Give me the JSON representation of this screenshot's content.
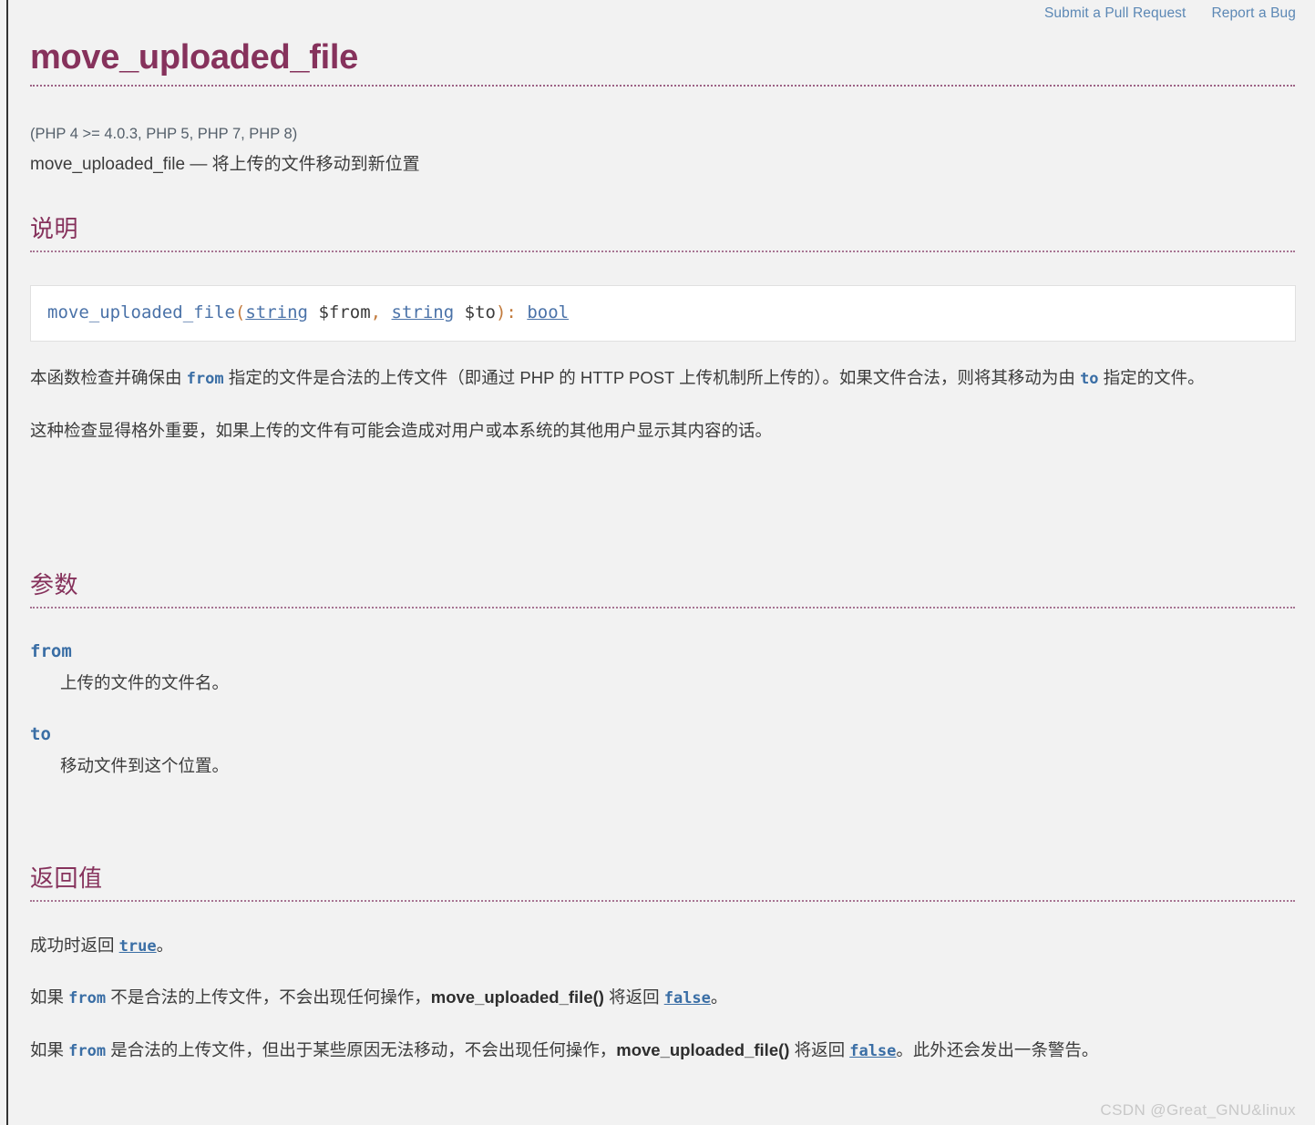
{
  "topbar": {
    "links": [
      {
        "label": "Submit a Pull Request",
        "name": "submit-pull-request-link"
      },
      {
        "label": "Report a Bug",
        "name": "report-a-bug-link"
      }
    ]
  },
  "page": {
    "title": "move_uploaded_file",
    "verinfo": "(PHP 4 >= 4.0.3, PHP 5, PHP 7, PHP 8)",
    "purpose": "move_uploaded_file — 将上传的文件移动到新位置"
  },
  "description": {
    "heading": "说明",
    "signature": {
      "function": "move_uploaded_file",
      "open_paren": "(",
      "arg1_type": "string",
      "arg1_name": "$from",
      "comma": ", ",
      "arg2_type": "string",
      "arg2_name": "$to",
      "close_paren": ")",
      "colon": ": ",
      "return_type": "bool"
    },
    "para1": {
      "t1": "本函数检查并确保由 ",
      "from": "from",
      "t2": " 指定的文件是合法的上传文件（即通过 PHP 的 HTTP POST 上传机制所上传的）。如果文件合法，则将其移动为由 ",
      "to": "to",
      "t3": " 指定的文件。"
    },
    "para2": "这种检查显得格外重要，如果上传的文件有可能会造成对用户或本系统的其他用户显示其内容的话。"
  },
  "parameters": {
    "heading": "参数",
    "items": [
      {
        "name": "from",
        "desc": "上传的文件的文件名。"
      },
      {
        "name": "to",
        "desc": "移动文件到这个位置。"
      }
    ]
  },
  "returnvalues": {
    "heading": "返回值",
    "para1": {
      "t1": "成功时返回 ",
      "true": "true",
      "t2": "。"
    },
    "para2": {
      "t1": "如果 ",
      "from": "from",
      "t2": " 不是合法的上传文件，不会出现任何操作，",
      "fn": "move_uploaded_file()",
      "t3": " 将返回 ",
      "false": "false",
      "t4": "。"
    },
    "para3": {
      "t1": "如果 ",
      "from": "from",
      "t2": " 是合法的上传文件，但出于某些原因无法移动，不会出现任何操作，",
      "fn": "move_uploaded_file()",
      "t3": " 将返回 ",
      "false": "false",
      "t4": "。此外还会发出一条警告。"
    }
  },
  "watermark": "CSDN @Great_GNU&linux",
  "colors": {
    "heading": "#86325c",
    "link": "#5c88b5",
    "code_link": "#3a6ea5",
    "background": "#f2f2f2"
  }
}
